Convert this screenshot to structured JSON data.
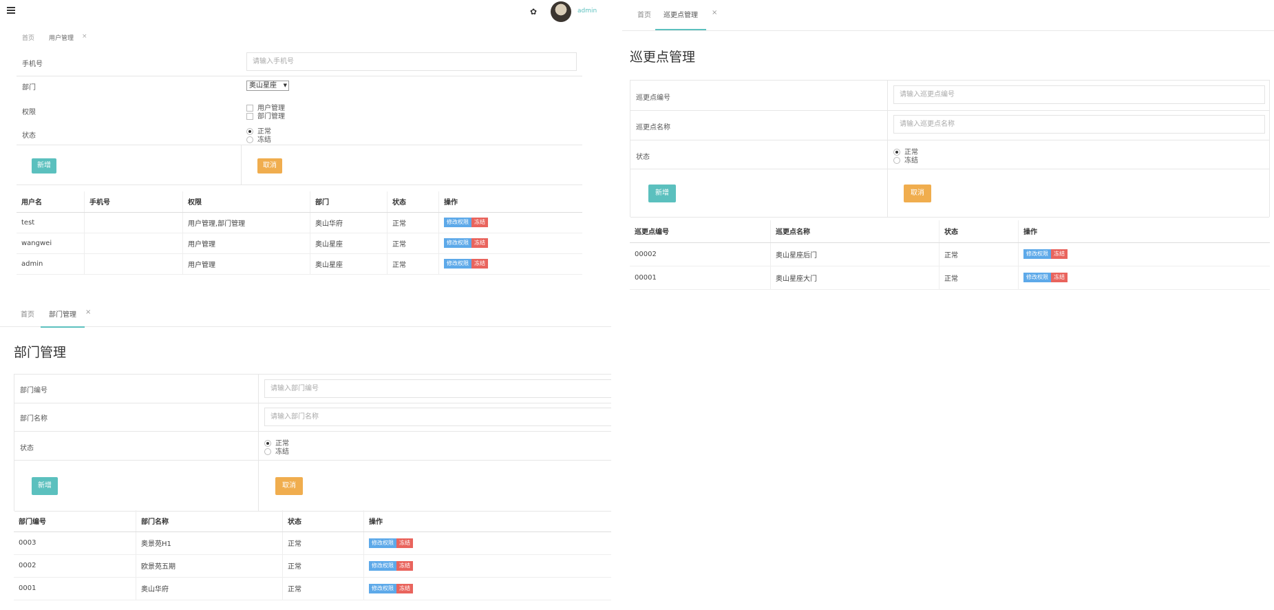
{
  "user_panel": {
    "header": {
      "username": "admin"
    },
    "tabs": {
      "home": "首页",
      "current": "用户管理",
      "close": "×"
    },
    "form": {
      "phone_label": "手机号",
      "phone_placeholder": "请输入手机号",
      "dept_label": "部门",
      "dept_selected": "奥山星座",
      "perm_label": "权限",
      "perm_options": [
        "用户管理",
        "部门管理"
      ],
      "status_label": "状态",
      "status_options": [
        "正常",
        "冻结"
      ],
      "add_button": "新增",
      "cancel_button": "取消"
    },
    "table": {
      "headers": [
        "用户名",
        "手机号",
        "权限",
        "部门",
        "状态",
        "操作"
      ],
      "rows": [
        {
          "name": "test",
          "phone": "",
          "perm": "用户管理,部门管理",
          "dept": "奥山华府",
          "status": "正常"
        },
        {
          "name": "wangwei",
          "phone": "",
          "perm": "用户管理",
          "dept": "奥山星座",
          "status": "正常"
        },
        {
          "name": "admin",
          "phone": "",
          "perm": "用户管理",
          "dept": "奥山星座",
          "status": "正常"
        }
      ],
      "edit_label": "修改权限",
      "freeze_label": "冻结"
    }
  },
  "patrol_panel": {
    "tabs": {
      "home": "首页",
      "current": "巡更点管理",
      "close": "×"
    },
    "title": "巡更点管理",
    "form": {
      "code_label": "巡更点编号",
      "code_placeholder": "请输入巡更点编号",
      "name_label": "巡更点名称",
      "name_placeholder": "请输入巡更点名称",
      "status_label": "状态",
      "status_options": [
        "正常",
        "冻结"
      ],
      "add_button": "新增",
      "cancel_button": "取消"
    },
    "table": {
      "headers": [
        "巡更点编号",
        "巡更点名称",
        "状态",
        "操作"
      ],
      "rows": [
        {
          "code": "00002",
          "name": "奥山星座后门",
          "status": "正常"
        },
        {
          "code": "00001",
          "name": "奥山星座大门",
          "status": "正常"
        }
      ],
      "edit_label": "修改权限",
      "freeze_label": "冻结"
    }
  },
  "dept_panel": {
    "tabs": {
      "home": "首页",
      "current": "部门管理",
      "close": "×"
    },
    "title": "部门管理",
    "form": {
      "code_label": "部门编号",
      "code_placeholder": "请输入部门编号",
      "name_label": "部门名称",
      "name_placeholder": "请输入部门名称",
      "status_label": "状态",
      "status_options": [
        "正常",
        "冻结"
      ],
      "add_button": "新增",
      "cancel_button": "取消"
    },
    "table": {
      "headers": [
        "部门编号",
        "部门名称",
        "状态",
        "操作"
      ],
      "rows": [
        {
          "code": "0003",
          "name": "奥景苑H1",
          "status": "正常"
        },
        {
          "code": "0002",
          "name": "欧景苑五期",
          "status": "正常"
        },
        {
          "code": "0001",
          "name": "奥山华府",
          "status": "正常"
        }
      ],
      "edit_label": "修改权限",
      "freeze_label": "冻结"
    }
  }
}
